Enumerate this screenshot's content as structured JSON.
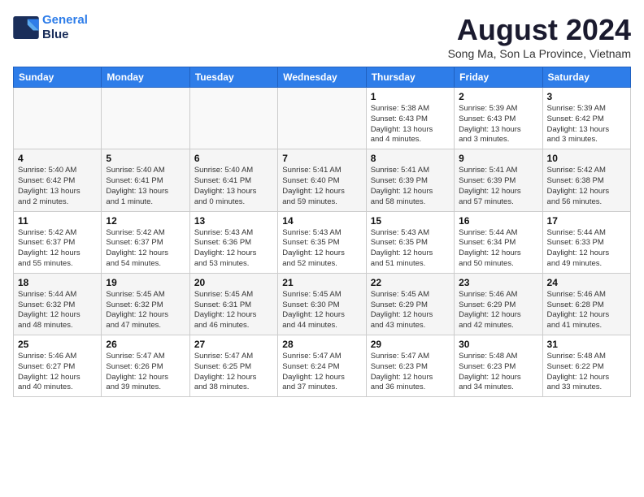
{
  "header": {
    "logo_line1": "General",
    "logo_line2": "Blue",
    "title": "August 2024",
    "subtitle": "Song Ma, Son La Province, Vietnam"
  },
  "weekdays": [
    "Sunday",
    "Monday",
    "Tuesday",
    "Wednesday",
    "Thursday",
    "Friday",
    "Saturday"
  ],
  "weeks": [
    [
      {
        "day": "",
        "info": ""
      },
      {
        "day": "",
        "info": ""
      },
      {
        "day": "",
        "info": ""
      },
      {
        "day": "",
        "info": ""
      },
      {
        "day": "1",
        "info": "Sunrise: 5:38 AM\nSunset: 6:43 PM\nDaylight: 13 hours\nand 4 minutes."
      },
      {
        "day": "2",
        "info": "Sunrise: 5:39 AM\nSunset: 6:43 PM\nDaylight: 13 hours\nand 3 minutes."
      },
      {
        "day": "3",
        "info": "Sunrise: 5:39 AM\nSunset: 6:42 PM\nDaylight: 13 hours\nand 3 minutes."
      }
    ],
    [
      {
        "day": "4",
        "info": "Sunrise: 5:40 AM\nSunset: 6:42 PM\nDaylight: 13 hours\nand 2 minutes."
      },
      {
        "day": "5",
        "info": "Sunrise: 5:40 AM\nSunset: 6:41 PM\nDaylight: 13 hours\nand 1 minute."
      },
      {
        "day": "6",
        "info": "Sunrise: 5:40 AM\nSunset: 6:41 PM\nDaylight: 13 hours\nand 0 minutes."
      },
      {
        "day": "7",
        "info": "Sunrise: 5:41 AM\nSunset: 6:40 PM\nDaylight: 12 hours\nand 59 minutes."
      },
      {
        "day": "8",
        "info": "Sunrise: 5:41 AM\nSunset: 6:39 PM\nDaylight: 12 hours\nand 58 minutes."
      },
      {
        "day": "9",
        "info": "Sunrise: 5:41 AM\nSunset: 6:39 PM\nDaylight: 12 hours\nand 57 minutes."
      },
      {
        "day": "10",
        "info": "Sunrise: 5:42 AM\nSunset: 6:38 PM\nDaylight: 12 hours\nand 56 minutes."
      }
    ],
    [
      {
        "day": "11",
        "info": "Sunrise: 5:42 AM\nSunset: 6:37 PM\nDaylight: 12 hours\nand 55 minutes."
      },
      {
        "day": "12",
        "info": "Sunrise: 5:42 AM\nSunset: 6:37 PM\nDaylight: 12 hours\nand 54 minutes."
      },
      {
        "day": "13",
        "info": "Sunrise: 5:43 AM\nSunset: 6:36 PM\nDaylight: 12 hours\nand 53 minutes."
      },
      {
        "day": "14",
        "info": "Sunrise: 5:43 AM\nSunset: 6:35 PM\nDaylight: 12 hours\nand 52 minutes."
      },
      {
        "day": "15",
        "info": "Sunrise: 5:43 AM\nSunset: 6:35 PM\nDaylight: 12 hours\nand 51 minutes."
      },
      {
        "day": "16",
        "info": "Sunrise: 5:44 AM\nSunset: 6:34 PM\nDaylight: 12 hours\nand 50 minutes."
      },
      {
        "day": "17",
        "info": "Sunrise: 5:44 AM\nSunset: 6:33 PM\nDaylight: 12 hours\nand 49 minutes."
      }
    ],
    [
      {
        "day": "18",
        "info": "Sunrise: 5:44 AM\nSunset: 6:32 PM\nDaylight: 12 hours\nand 48 minutes."
      },
      {
        "day": "19",
        "info": "Sunrise: 5:45 AM\nSunset: 6:32 PM\nDaylight: 12 hours\nand 47 minutes."
      },
      {
        "day": "20",
        "info": "Sunrise: 5:45 AM\nSunset: 6:31 PM\nDaylight: 12 hours\nand 46 minutes."
      },
      {
        "day": "21",
        "info": "Sunrise: 5:45 AM\nSunset: 6:30 PM\nDaylight: 12 hours\nand 44 minutes."
      },
      {
        "day": "22",
        "info": "Sunrise: 5:45 AM\nSunset: 6:29 PM\nDaylight: 12 hours\nand 43 minutes."
      },
      {
        "day": "23",
        "info": "Sunrise: 5:46 AM\nSunset: 6:29 PM\nDaylight: 12 hours\nand 42 minutes."
      },
      {
        "day": "24",
        "info": "Sunrise: 5:46 AM\nSunset: 6:28 PM\nDaylight: 12 hours\nand 41 minutes."
      }
    ],
    [
      {
        "day": "25",
        "info": "Sunrise: 5:46 AM\nSunset: 6:27 PM\nDaylight: 12 hours\nand 40 minutes."
      },
      {
        "day": "26",
        "info": "Sunrise: 5:47 AM\nSunset: 6:26 PM\nDaylight: 12 hours\nand 39 minutes."
      },
      {
        "day": "27",
        "info": "Sunrise: 5:47 AM\nSunset: 6:25 PM\nDaylight: 12 hours\nand 38 minutes."
      },
      {
        "day": "28",
        "info": "Sunrise: 5:47 AM\nSunset: 6:24 PM\nDaylight: 12 hours\nand 37 minutes."
      },
      {
        "day": "29",
        "info": "Sunrise: 5:47 AM\nSunset: 6:23 PM\nDaylight: 12 hours\nand 36 minutes."
      },
      {
        "day": "30",
        "info": "Sunrise: 5:48 AM\nSunset: 6:23 PM\nDaylight: 12 hours\nand 34 minutes."
      },
      {
        "day": "31",
        "info": "Sunrise: 5:48 AM\nSunset: 6:22 PM\nDaylight: 12 hours\nand 33 minutes."
      }
    ]
  ]
}
